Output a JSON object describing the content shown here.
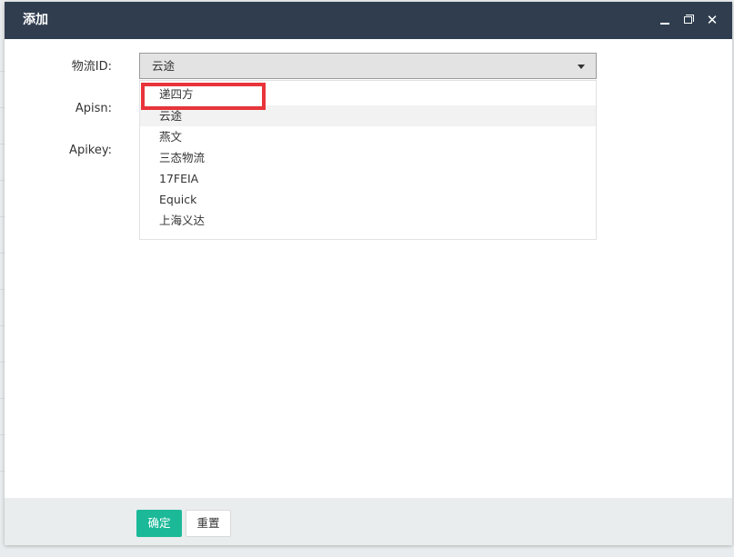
{
  "dialog": {
    "title": "添加",
    "controls": {
      "minimize_icon": "minimize-icon",
      "maximize_icon": "maximize-icon",
      "close_icon": "close-icon",
      "close_glyph": "✕"
    }
  },
  "form": {
    "logistics_label": "物流ID:",
    "apisn_label": "Apisn:",
    "apikey_label": "Apikey:",
    "logistics_select": {
      "value": "云途",
      "open": true,
      "options": [
        {
          "label": "递四方",
          "highlighted": true
        },
        {
          "label": "云途",
          "selected": true
        },
        {
          "label": "燕文"
        },
        {
          "label": "三态物流"
        },
        {
          "label": "17FEIA"
        },
        {
          "label": "Equick"
        },
        {
          "label": "上海义达"
        }
      ]
    }
  },
  "footer": {
    "confirm_label": "确定",
    "reset_label": "重置"
  },
  "colors": {
    "titlebar": "#2f3d4f",
    "primary_button": "#1cb999",
    "annotation_box": "#e8343a",
    "footer": "#eaedee"
  }
}
